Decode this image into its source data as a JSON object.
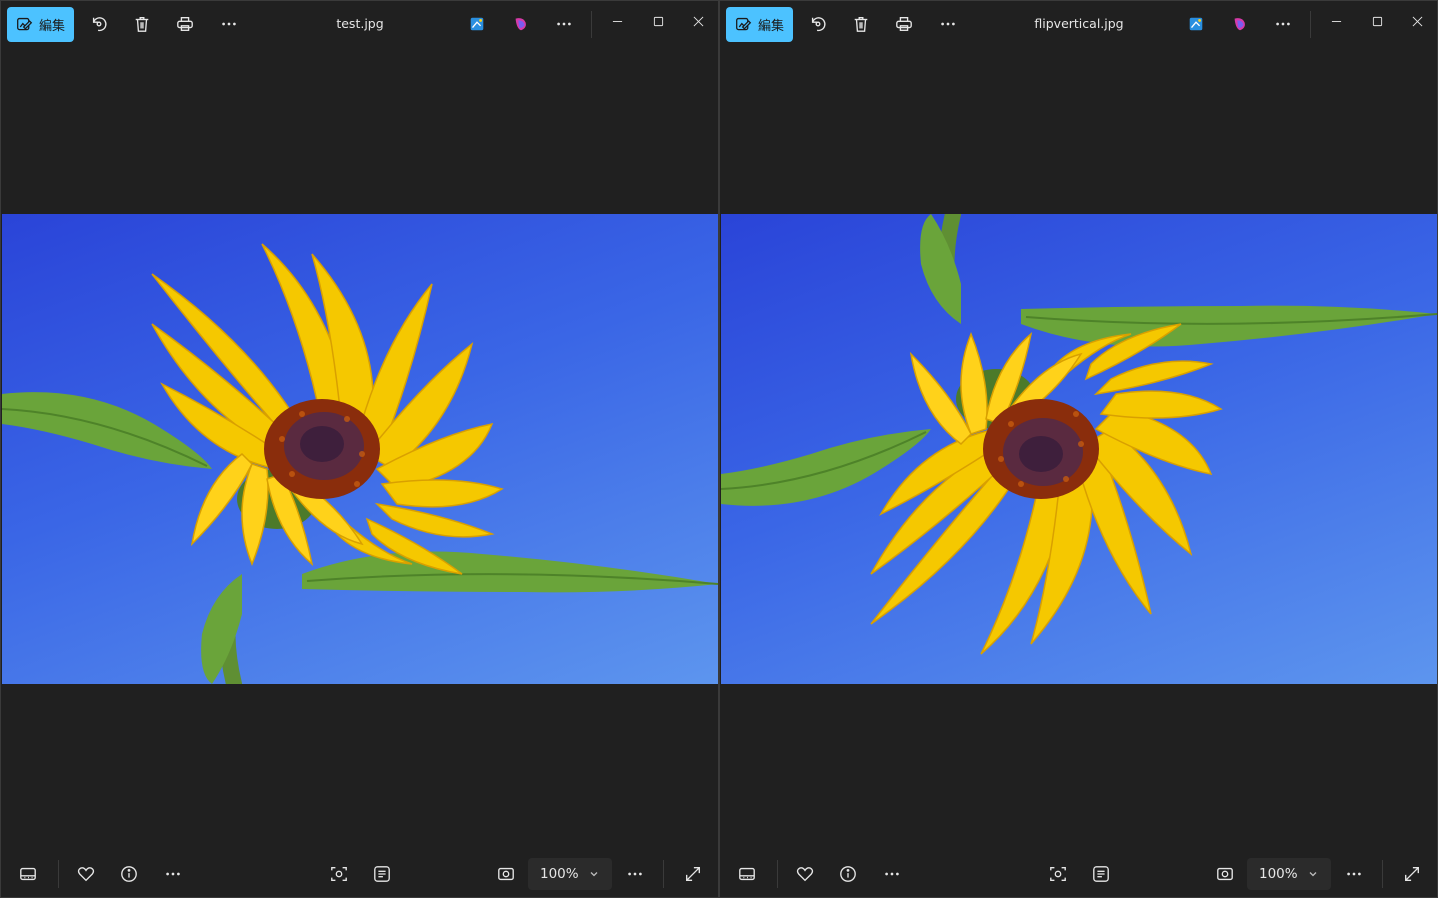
{
  "windows": [
    {
      "id": "left",
      "title": "test.jpg",
      "edit_label": "編集",
      "zoom": "100%",
      "flipped_vertical": false
    },
    {
      "id": "right",
      "title": "flipvertical.jpg",
      "edit_label": "編集",
      "zoom": "100%",
      "flipped_vertical": true
    }
  ],
  "icons": {
    "edit": "edit-photo-icon",
    "rotate": "rotate-icon",
    "delete": "trash-icon",
    "print": "print-icon",
    "more": "more-icon",
    "designer": "designer-icon",
    "copilot": "copilot-icon",
    "minimize": "minimize-icon",
    "maximize": "maximize-icon",
    "close": "close-icon",
    "filmstrip": "filmstrip-icon",
    "favorite": "heart-icon",
    "info": "info-icon",
    "visual_search": "visual-search-icon",
    "text_recognition": "text-scan-icon",
    "actual_size": "actual-size-icon",
    "chevron": "chevron-down-icon",
    "fullscreen": "fullscreen-icon"
  },
  "colors": {
    "accent": "#4cc2ff",
    "background": "#202020",
    "sky": "#2f58e2",
    "petal": "#f5c800",
    "leaf": "#6aa43a"
  }
}
